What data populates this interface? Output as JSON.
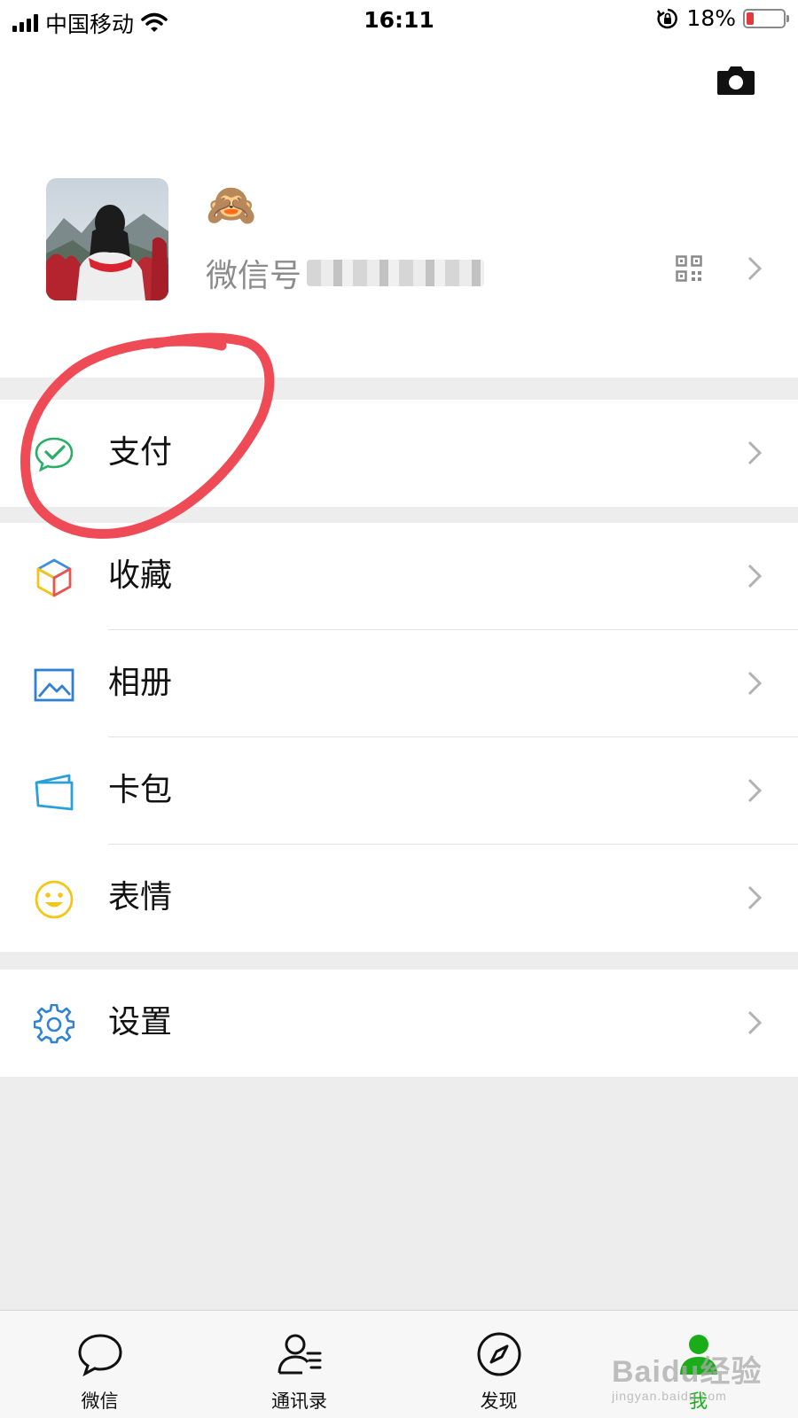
{
  "status_bar": {
    "carrier": "中国移动",
    "time": "16:11",
    "battery_percent": "18%",
    "battery_level": 0.18,
    "icons": [
      "signal-icon",
      "wifi-icon",
      "rotation-lock-icon",
      "battery-icon"
    ]
  },
  "profile": {
    "nickname": "🙈",
    "wechat_id_label": "微信号",
    "icons": [
      "camera-icon",
      "qr-code-icon",
      "chevron-right-icon"
    ]
  },
  "menu": {
    "pay": "支付",
    "favorites": "收藏",
    "album": "相册",
    "cards": "卡包",
    "stickers": "表情",
    "settings": "设置"
  },
  "tabs": [
    {
      "label": "微信",
      "icon": "chat-bubble-icon"
    },
    {
      "label": "通讯录",
      "icon": "contacts-icon"
    },
    {
      "label": "发现",
      "icon": "compass-icon"
    },
    {
      "label": "我",
      "icon": "me-icon",
      "active": true
    }
  ],
  "watermark": {
    "main": "Baidu经验",
    "sub": "jingyan.baidu.com"
  },
  "colors": {
    "accent_green": "#1aad19",
    "annotation_red": "#ef4b57",
    "background": "#ededed"
  }
}
